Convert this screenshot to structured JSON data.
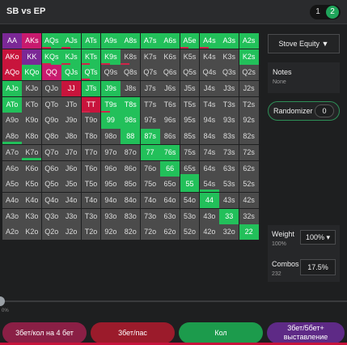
{
  "header": {
    "title": "SB vs EP",
    "pages": [
      "1",
      "2"
    ],
    "active_page": "2"
  },
  "grid": {
    "rows": [
      [
        [
          "AA",
          "p"
        ],
        [
          "AKs",
          "m"
        ],
        [
          "AQs",
          "g"
        ],
        [
          "AJs",
          "g"
        ],
        [
          "ATs",
          "g"
        ],
        [
          "A9s",
          "g"
        ],
        [
          "A8s",
          "g"
        ],
        [
          "A7s",
          "g"
        ],
        [
          "A6s",
          "g"
        ],
        [
          "A5e",
          "g"
        ],
        [
          "A4s",
          "g"
        ],
        [
          "A3s",
          "g"
        ],
        [
          "A2s",
          "g"
        ]
      ],
      [
        [
          "AKo",
          "r"
        ],
        [
          "KK",
          "p"
        ],
        [
          "KQs",
          "g"
        ],
        [
          "KJs",
          "g"
        ],
        [
          "KTs",
          "g"
        ],
        [
          "K9s",
          "g"
        ],
        [
          "K8s",
          "n"
        ],
        [
          "K7s",
          "n"
        ],
        [
          "K6s",
          "n"
        ],
        [
          "K5s",
          "n"
        ],
        [
          "K4s",
          "n"
        ],
        [
          "K3s",
          "n"
        ],
        [
          "K2s",
          "g"
        ]
      ],
      [
        [
          "AQo",
          "r"
        ],
        [
          "KQo",
          "g"
        ],
        [
          "QQ",
          "m"
        ],
        [
          "QJs",
          "g"
        ],
        [
          "QTs",
          "g"
        ],
        [
          "Q9s",
          "n"
        ],
        [
          "Q8s",
          "n"
        ],
        [
          "Q7s",
          "n"
        ],
        [
          "Q6s",
          "n"
        ],
        [
          "Q5s",
          "n"
        ],
        [
          "Q4s",
          "n"
        ],
        [
          "Q3s",
          "n"
        ],
        [
          "Q2s",
          "n"
        ]
      ],
      [
        [
          "AJo",
          "g"
        ],
        [
          "KJo",
          "n"
        ],
        [
          "QJo",
          "n"
        ],
        [
          "JJ",
          "r"
        ],
        [
          "JTs",
          "g"
        ],
        [
          "J9s",
          "g"
        ],
        [
          "J8s",
          "n"
        ],
        [
          "J7s",
          "n"
        ],
        [
          "J6s",
          "n"
        ],
        [
          "J5s",
          "n"
        ],
        [
          "J4s",
          "n"
        ],
        [
          "J3s",
          "n"
        ],
        [
          "J2s",
          "n"
        ]
      ],
      [
        [
          "ATo",
          "g"
        ],
        [
          "KTo",
          "n"
        ],
        [
          "QTo",
          "n"
        ],
        [
          "JTo",
          "n"
        ],
        [
          "TT",
          "r"
        ],
        [
          "T9s",
          "g"
        ],
        [
          "T8s",
          "g"
        ],
        [
          "T7s",
          "n"
        ],
        [
          "T6s",
          "n"
        ],
        [
          "T5s",
          "n"
        ],
        [
          "T4s",
          "n"
        ],
        [
          "T3s",
          "n"
        ],
        [
          "T2s",
          "n"
        ]
      ],
      [
        [
          "A9o",
          "n"
        ],
        [
          "K9o",
          "n"
        ],
        [
          "Q9o",
          "n"
        ],
        [
          "J9o",
          "n"
        ],
        [
          "T9o",
          "n"
        ],
        [
          "99",
          "g"
        ],
        [
          "98s",
          "g"
        ],
        [
          "97s",
          "n"
        ],
        [
          "96s",
          "n"
        ],
        [
          "95s",
          "n"
        ],
        [
          "94s",
          "n"
        ],
        [
          "93s",
          "n"
        ],
        [
          "92s",
          "n"
        ]
      ],
      [
        [
          "A8o",
          "n"
        ],
        [
          "K8o",
          "n"
        ],
        [
          "Q8o",
          "n"
        ],
        [
          "J8o",
          "n"
        ],
        [
          "T8o",
          "n"
        ],
        [
          "98o",
          "n"
        ],
        [
          "88",
          "g"
        ],
        [
          "87s",
          "g"
        ],
        [
          "86s",
          "n"
        ],
        [
          "85s",
          "n"
        ],
        [
          "84s",
          "n"
        ],
        [
          "83s",
          "n"
        ],
        [
          "82s",
          "n"
        ]
      ],
      [
        [
          "A7o",
          "n"
        ],
        [
          "K7o",
          "n"
        ],
        [
          "Q7o",
          "n"
        ],
        [
          "J7o",
          "n"
        ],
        [
          "T7o",
          "n"
        ],
        [
          "97o",
          "n"
        ],
        [
          "87o",
          "n"
        ],
        [
          "77",
          "g"
        ],
        [
          "76s",
          "g"
        ],
        [
          "75s",
          "n"
        ],
        [
          "74s",
          "n"
        ],
        [
          "73s",
          "n"
        ],
        [
          "72s",
          "n"
        ]
      ],
      [
        [
          "A6o",
          "n"
        ],
        [
          "K6o",
          "n"
        ],
        [
          "Q6o",
          "n"
        ],
        [
          "J6o",
          "n"
        ],
        [
          "T6o",
          "n"
        ],
        [
          "96o",
          "n"
        ],
        [
          "86o",
          "n"
        ],
        [
          "76o",
          "n"
        ],
        [
          "66",
          "g"
        ],
        [
          "65s",
          "n"
        ],
        [
          "64s",
          "n"
        ],
        [
          "63s",
          "n"
        ],
        [
          "62s",
          "n"
        ]
      ],
      [
        [
          "A5o",
          "n"
        ],
        [
          "K5o",
          "n"
        ],
        [
          "Q5o",
          "n"
        ],
        [
          "J5o",
          "n"
        ],
        [
          "T5o",
          "n"
        ],
        [
          "95o",
          "n"
        ],
        [
          "85o",
          "n"
        ],
        [
          "75o",
          "n"
        ],
        [
          "65o",
          "n"
        ],
        [
          "55",
          "g"
        ],
        [
          "54s",
          "n"
        ],
        [
          "53s",
          "n"
        ],
        [
          "52s",
          "n"
        ]
      ],
      [
        [
          "A4o",
          "n"
        ],
        [
          "K4o",
          "n"
        ],
        [
          "Q4o",
          "n"
        ],
        [
          "J4o",
          "n"
        ],
        [
          "T4o",
          "n"
        ],
        [
          "94o",
          "n"
        ],
        [
          "84o",
          "n"
        ],
        [
          "74o",
          "n"
        ],
        [
          "64o",
          "n"
        ],
        [
          "54o",
          "n"
        ],
        [
          "44",
          "g"
        ],
        [
          "43s",
          "n"
        ],
        [
          "42s",
          "n"
        ]
      ],
      [
        [
          "A3o",
          "n"
        ],
        [
          "K3o",
          "n"
        ],
        [
          "Q3o",
          "n"
        ],
        [
          "J3o",
          "n"
        ],
        [
          "T3o",
          "n"
        ],
        [
          "93o",
          "n"
        ],
        [
          "83o",
          "n"
        ],
        [
          "73o",
          "n"
        ],
        [
          "63o",
          "n"
        ],
        [
          "53o",
          "n"
        ],
        [
          "43o",
          "n"
        ],
        [
          "33",
          "g"
        ],
        [
          "32s",
          "n"
        ]
      ],
      [
        [
          "A2o",
          "n"
        ],
        [
          "K2o",
          "n"
        ],
        [
          "Q2o",
          "n"
        ],
        [
          "J2o",
          "n"
        ],
        [
          "T2o",
          "n"
        ],
        [
          "92o",
          "n"
        ],
        [
          "82o",
          "n"
        ],
        [
          "72o",
          "n"
        ],
        [
          "62o",
          "n"
        ],
        [
          "52o",
          "n"
        ],
        [
          "42o",
          "n"
        ],
        [
          "32o",
          "n"
        ],
        [
          "22",
          "g"
        ]
      ]
    ],
    "red_underline_cells": [
      "AQs",
      "AJs",
      "A5e",
      "A4s",
      "KQs",
      "KJs",
      "KTs",
      "K9s",
      "K8s",
      "QTs",
      "TT",
      "T9s"
    ],
    "green_underline_cells": [
      "65s",
      "54s",
      "98s",
      "A8o",
      "K7o"
    ],
    "colors": {
      "raise": "#22c05a",
      "purple": "#7b2896",
      "red": "#c8143c",
      "magenta": "#c81a6e",
      "neutral": "#4b4b4b"
    }
  },
  "sidebar": {
    "equity_dropdown": "Stove Equity ▼",
    "notes_title": "Notes",
    "notes_sub": "None",
    "randomizer_label": "Randomizer",
    "randomizer_value": "0",
    "weight_label": "Weight",
    "weight_sub": "100%",
    "weight_value": "100% ▾",
    "combos_label": "Combos",
    "combos_sub": "232",
    "combos_value": "17.5%"
  },
  "slider": {
    "label": "0%",
    "value": 0
  },
  "actions": [
    {
      "label": "3бет/кол на 4 бет",
      "color": "#8a1f45"
    },
    {
      "label": "3бет/пас",
      "color": "#9b1b2b"
    },
    {
      "label": "Кол",
      "color": "#1c9b4c"
    },
    {
      "label": "3бет/5бет+ выставление",
      "color": "#5e2a86"
    }
  ]
}
